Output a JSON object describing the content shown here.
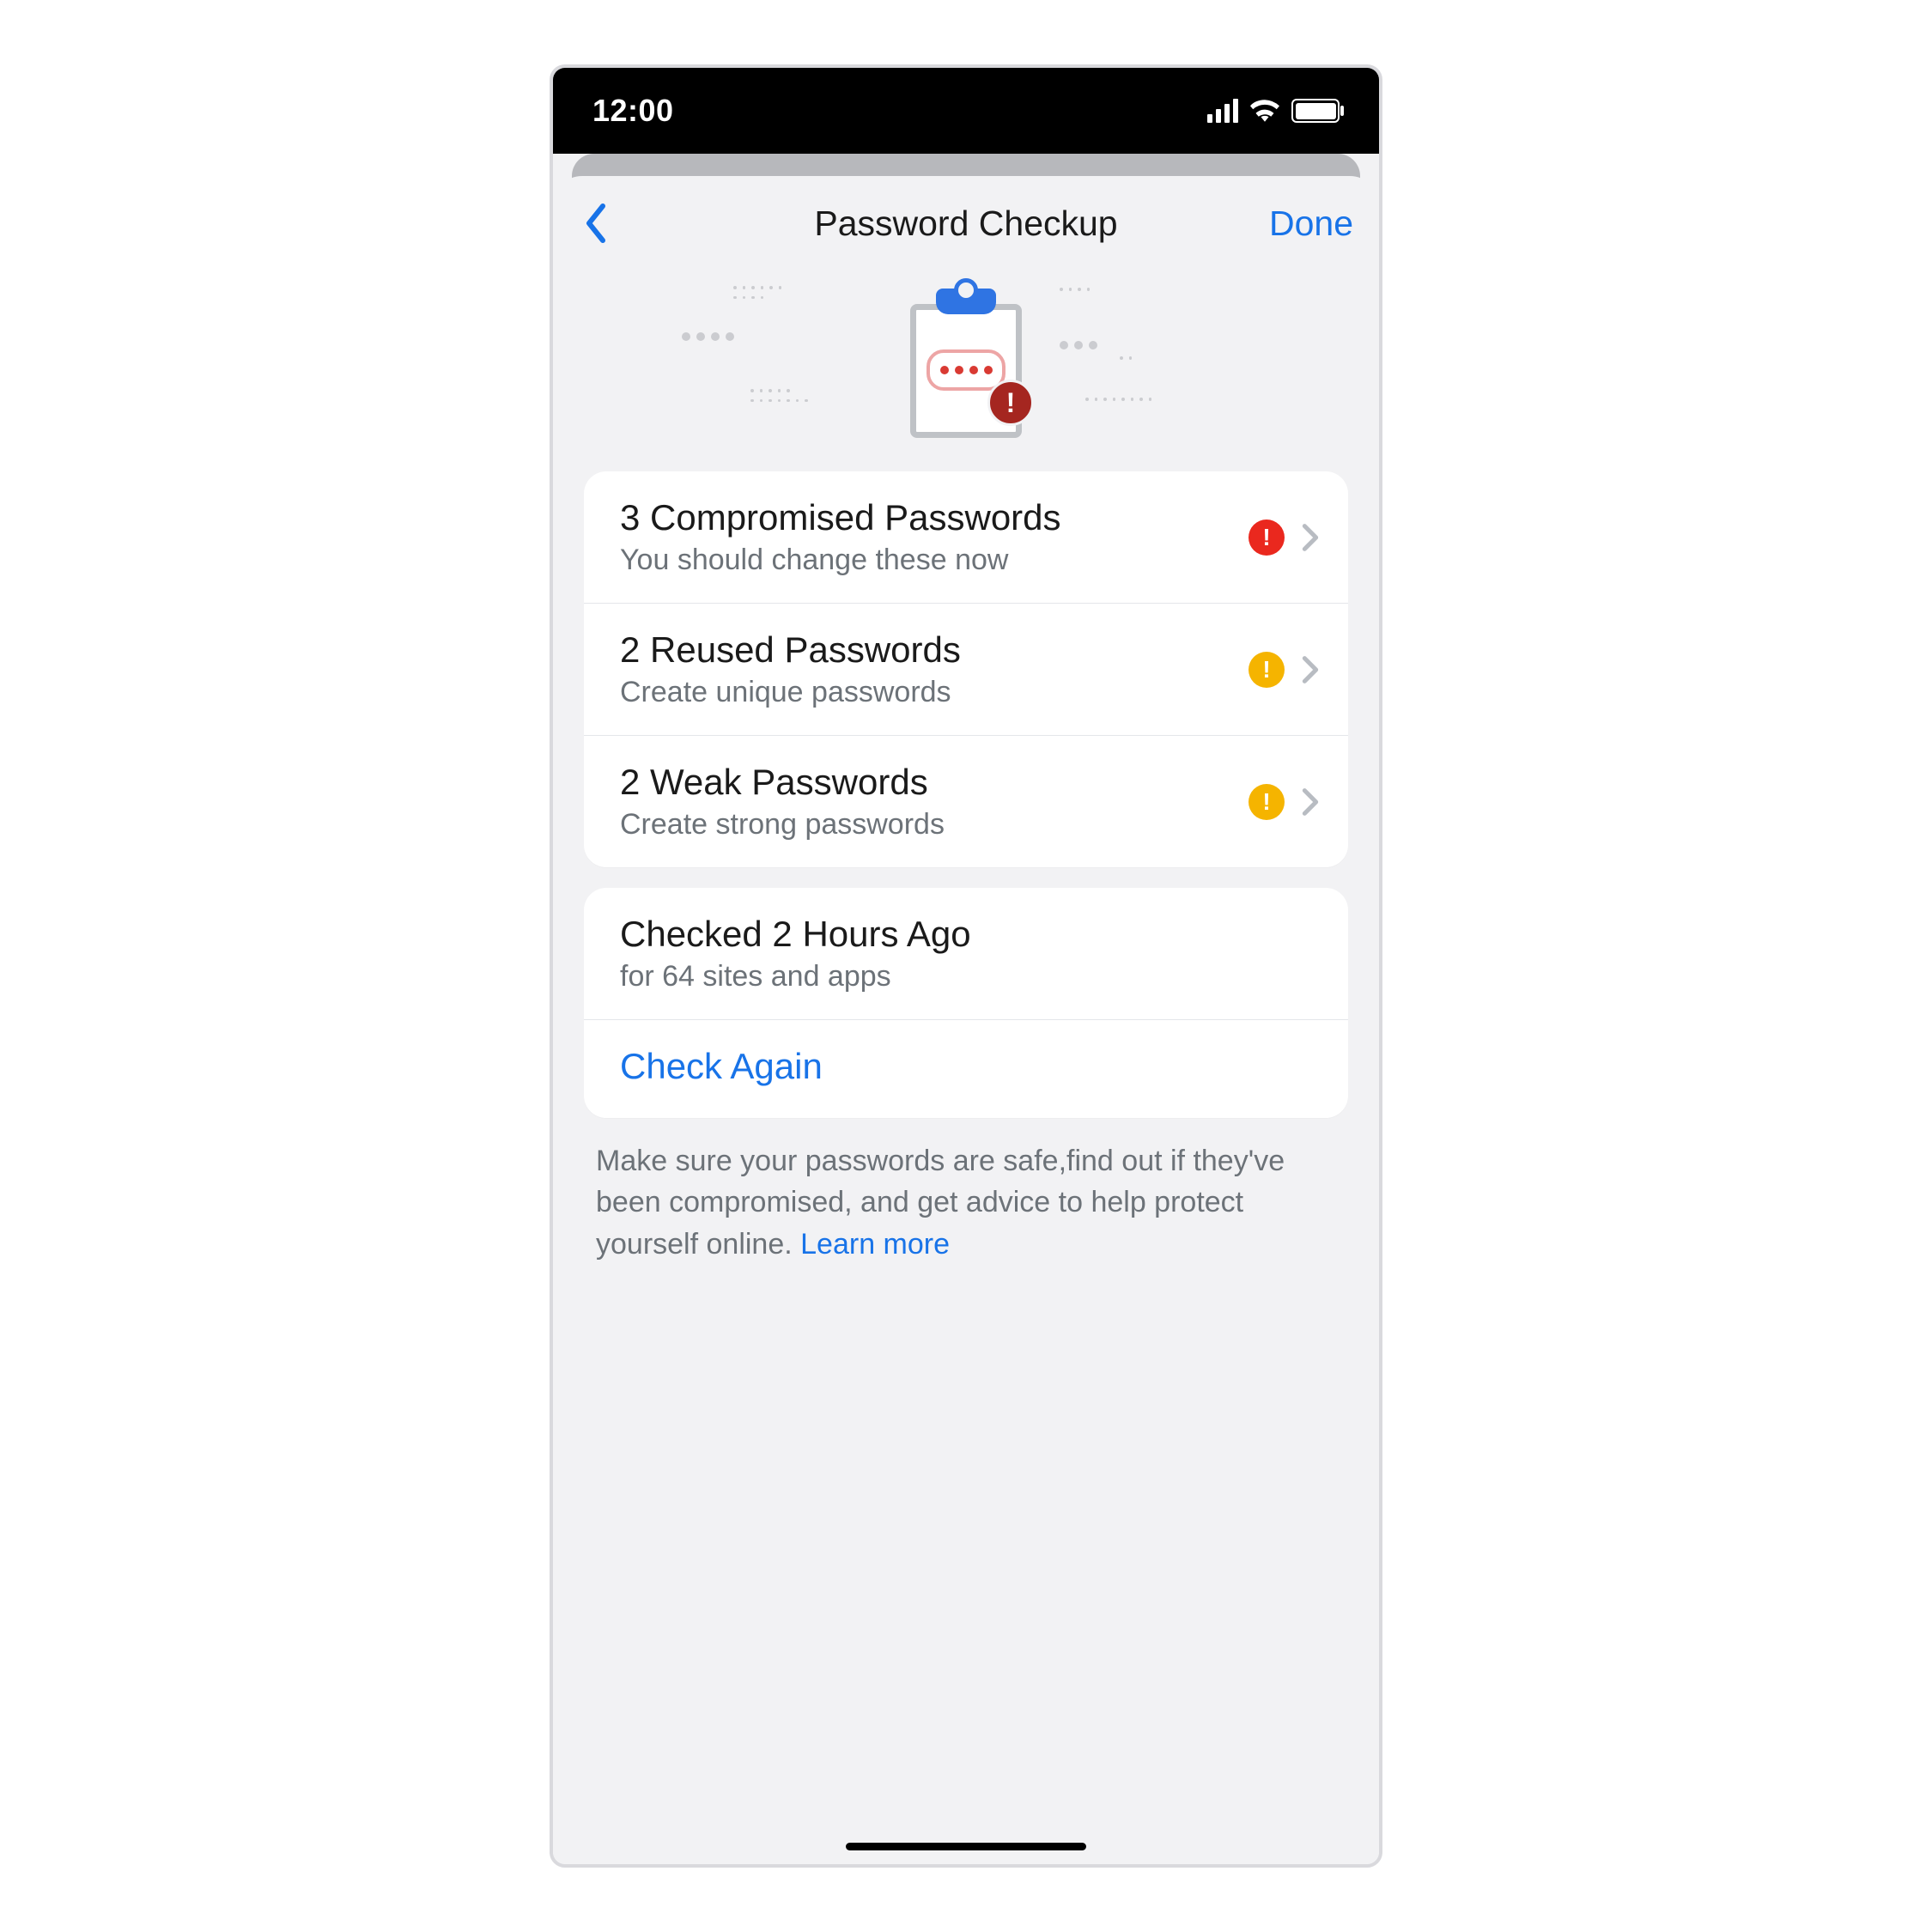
{
  "statusbar": {
    "time": "12:00"
  },
  "nav": {
    "title": "Password Checkup",
    "done_label": "Done"
  },
  "issues": [
    {
      "title": "3 Compromised Passwords",
      "sub": "You should change these now",
      "badge": "red"
    },
    {
      "title": "2 Reused Passwords",
      "sub": "Create unique passwords",
      "badge": "yellow"
    },
    {
      "title": "2 Weak Passwords",
      "sub": "Create strong passwords",
      "badge": "yellow"
    }
  ],
  "status": {
    "title": "Checked 2 Hours Ago",
    "sub": "for 64 sites and apps",
    "check_again_label": "Check Again"
  },
  "footer": {
    "text": "Make sure your passwords are safe,find out if they've been compromised, and get advice to help protect yourself online. ",
    "learn_more_label": "Learn more"
  }
}
